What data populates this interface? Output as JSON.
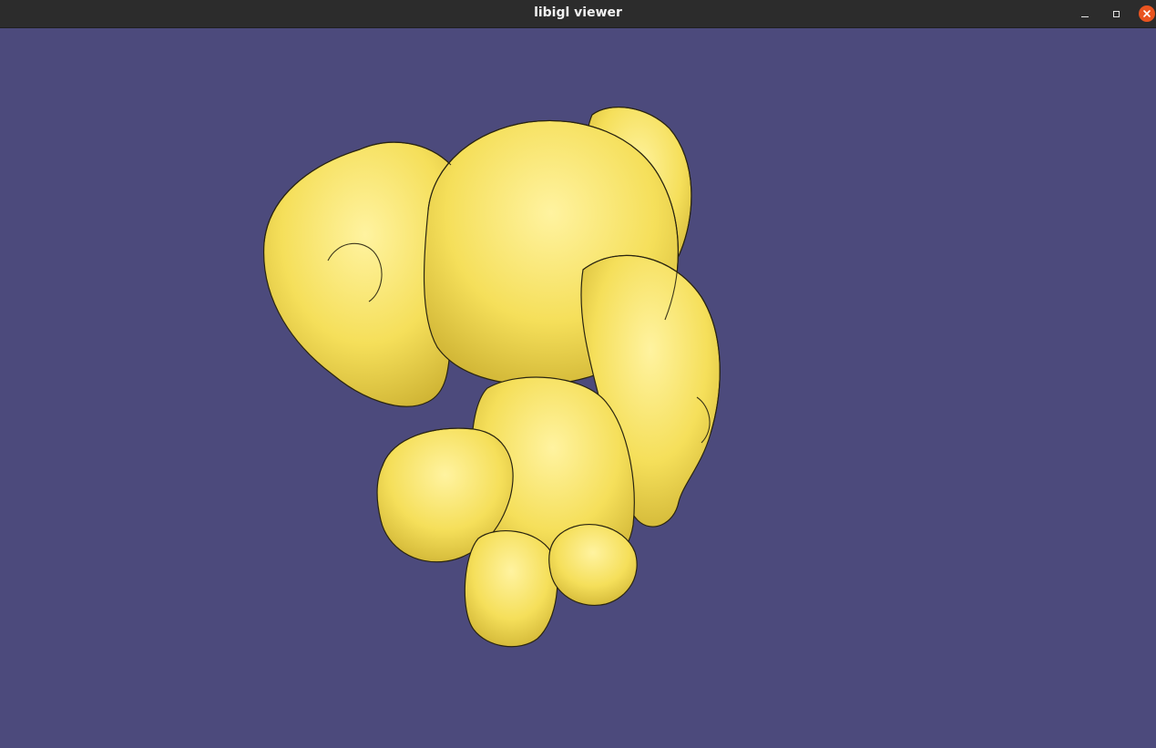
{
  "window": {
    "title": "libigl viewer"
  },
  "viewport": {
    "background_color": "#4c4a7c",
    "mesh_color": "#f3de5c",
    "wire_color": "#1f1c10"
  },
  "icons": {
    "minimize": "minimize-icon",
    "maximize": "maximize-icon",
    "close": "close-icon"
  },
  "accent_color": "#e95420"
}
